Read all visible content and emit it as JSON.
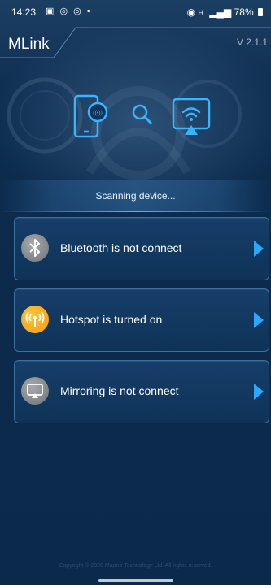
{
  "status_bar": {
    "time": "14:23",
    "left_icons": "▣ ◎ ◎ •",
    "network": "H",
    "battery": "78%"
  },
  "header": {
    "title": "MLink",
    "version": "V 2.1.1"
  },
  "scan": {
    "status_text": "Scanning device..."
  },
  "cards": [
    {
      "label": "Bluetooth is not connect",
      "icon": "bluetooth-icon",
      "color": "#8e9094"
    },
    {
      "label": "Hotspot is turned on",
      "icon": "hotspot-icon",
      "color": "#f7a71c"
    },
    {
      "label": "Mirroring is not connect",
      "icon": "mirroring-icon",
      "color": "#8e9094"
    }
  ],
  "footer": {
    "copyright": "Copyright © 2020 Maono Technology Ltd. All rights reserved."
  },
  "colors": {
    "accent": "#2aa8ff",
    "card_border": "#3d6f9f",
    "background": "#0c2b4d"
  }
}
